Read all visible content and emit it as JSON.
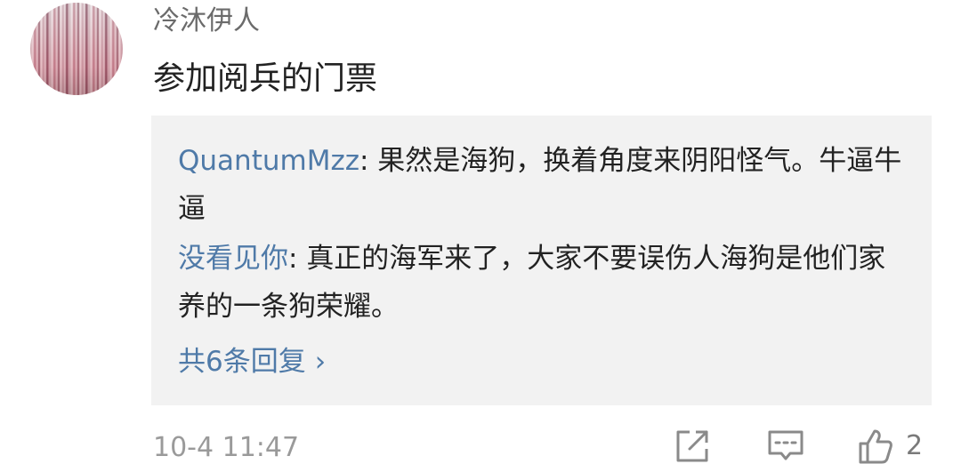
{
  "comment": {
    "username": "冷沐伊人",
    "text": "参加阅兵的门票",
    "timestamp": "10-4 11:47",
    "like_count": "2"
  },
  "replies": [
    {
      "user": "QuantumMzz",
      "separator": ": ",
      "text": "果然是海狗，换着角度来阴阳怪气。牛逼牛逼"
    },
    {
      "user": "没看见你",
      "separator": ": ",
      "text": "真正的海军来了，大家不要误伤人海狗是他们家养的一条狗荣耀。"
    }
  ],
  "more_replies": {
    "label": "共6条回复",
    "chevron": "›"
  },
  "icons": {
    "share": "share-icon",
    "reply": "comment-icon",
    "like": "thumbs-up-icon"
  },
  "colors": {
    "link_blue": "#4f7aa8",
    "reply_bg": "#f2f2f2",
    "text": "#222222",
    "muted": "#9a9a9a"
  }
}
